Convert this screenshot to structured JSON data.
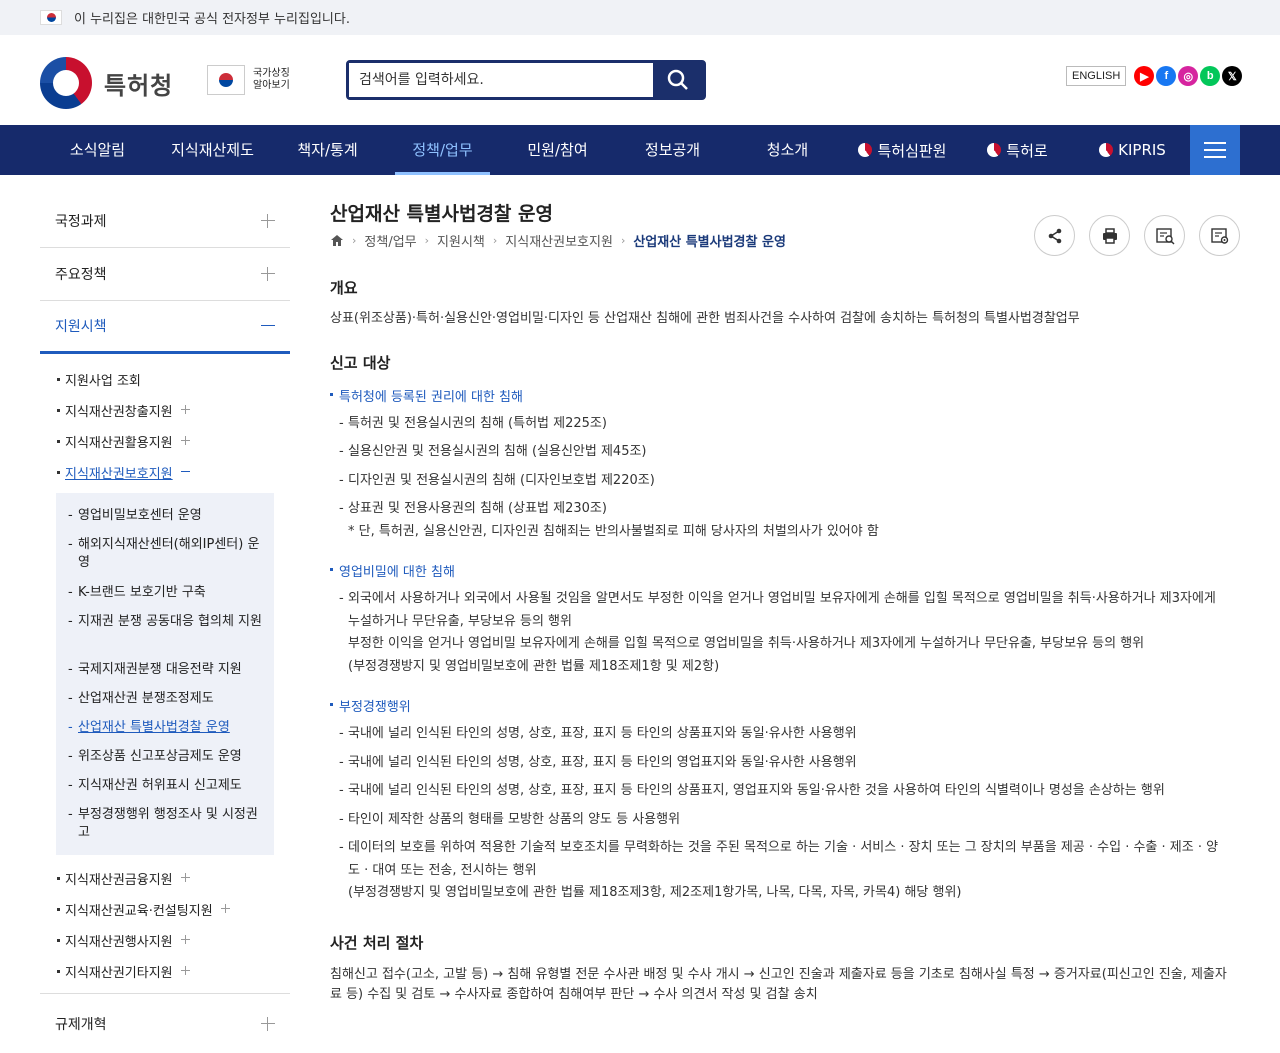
{
  "govbar": {
    "text": "이 누리집은 대한민국 공식 전자정부 누리집입니다."
  },
  "header": {
    "logo_text": "특허청",
    "symbol_text": "국가상징 알아보기",
    "search_placeholder": "검색어를 입력하세요.",
    "english_label": "ENGLISH",
    "sns": [
      {
        "icon": "youtube-icon",
        "glyph": "▶",
        "color": "#ff0000"
      },
      {
        "icon": "facebook-icon",
        "glyph": "f",
        "color": "#1877f2"
      },
      {
        "icon": "instagram-icon",
        "glyph": "◎",
        "color": "#d6249f"
      },
      {
        "icon": "blog-icon",
        "glyph": "b",
        "color": "#03c75a"
      },
      {
        "icon": "x-icon",
        "glyph": "𝕏",
        "color": "#000000"
      }
    ]
  },
  "nav": {
    "items": [
      "소식알림",
      "지식재산제도",
      "책자/통계",
      "정책/업무",
      "민원/참여",
      "정보공개",
      "청소개"
    ],
    "active_index": 3,
    "subsites": [
      "특허심판원",
      "특허로",
      "KIPRIS"
    ],
    "accent": "#162a6b"
  },
  "lnb": {
    "top": [
      "국정과제",
      "주요정책",
      "지원시책"
    ],
    "level2": [
      "지원사업 조회",
      "지식재산권창출지원",
      "지식재산권활용지원",
      "지식재산권보호지원"
    ],
    "level3": [
      "영업비밀보호센터 운영",
      "해외지식재산센터(해외IP센터) 운영",
      "K-브랜드 보호기반 구축",
      "지재권 분쟁 공동대응 협의체 지원",
      "국제지재권분쟁 대응전략 지원",
      "산업재산권 분쟁조정제도",
      "산업재산 특별사법경찰 운영",
      "위조상품 신고포상금제도 운영",
      "지식재산권 허위표시 신고제도",
      "부정경쟁행위 행정조사 및 시정권고"
    ],
    "level2_after": [
      "지식재산권금융지원",
      "지식재산권교육·컨설팅지원",
      "지식재산권행사지원",
      "지식재산권기타지원"
    ],
    "bottom": "규제개혁"
  },
  "content": {
    "title": "산업재산 특별사법경찰 운영",
    "breadcrumb": [
      "정책/업무",
      "지원시책",
      "지식재산권보호지원",
      "산업재산 특별사법경찰 운영"
    ],
    "overview_heading": "개요",
    "overview_text": "상표(위조상품)·특허·실용신안·영업비밀·디자인 등 산업재산 침해에 관한 범죄사건을 수사하여 검찰에 송치하는 특허청의 특별사법경찰업무",
    "report_heading": "신고 대상",
    "sec1_title": "특허청에 등록된 권리에 대한 침해",
    "sec1_items": [
      "특허권 및 전용실시권의 침해 (특허법 제225조)",
      "실용신안권 및 전용실시권의 침해 (실용신안법 제45조)",
      "디자인권 및 전용실시권의 침해 (디자인보호법 제220조)",
      "상표권 및 전용사용권의 침해 (상표법 제230조)"
    ],
    "sec1_note": "* 단, 특허권, 실용신안권, 디자인권 침해죄는 반의사불벌죄로 피해 당사자의 처벌의사가 있어야 함",
    "sec2_title": "영업비밀에 대한 침해",
    "sec2_item_line1": "외국에서 사용하거나 외국에서 사용될 것임을 알면서도 부정한 이익을 얻거나 영업비밀 보유자에게 손해를 입힐 목적으로 영업비밀을 취득·사용하거나 제3자에게",
    "sec2_item_line2": "누설하거나 무단유출, 부당보유 등의 행위",
    "sec2_item_line3": "부정한 이익을 얻거나 영업비밀 보유자에게 손해를 입힐 목적으로 영업비밀을 취득·사용하거나 제3자에게 누설하거나 무단유출, 부당보유 등의 행위",
    "sec2_item_line4": "(부정경쟁방지 및 영업비밀보호에 관한 법률 제18조제1항 및 제2항)",
    "sec3_title": "부정경쟁행위",
    "sec3_items": [
      "국내에 널리 인식된 타인의 성명, 상호, 표장, 표지 등 타인의 상품표지와 동일·유사한 사용행위",
      "국내에 널리 인식된 타인의 성명, 상호, 표장, 표지 등 타인의 영업표지와 동일·유사한 사용행위",
      "국내에 널리 인식된 타인의 성명, 상호, 표장, 표지 등 타인의 상품표지, 영업표지와 동일·유사한 것을 사용하여 타인의 식별력이나 명성을 손상하는 행위",
      "타인이 제작한 상품의 형태를 모방한 상품의 양도 등 사용행위"
    ],
    "sec3_last_line1": "데이터의 보호를 위하여 적용한 기술적 보호조치를 무력화하는 것을 주된 목적으로 하는 기술 · 서비스 · 장치 또는 그 장치의 부품을 제공 · 수입 · 수출 · 제조 · 양",
    "sec3_last_line2": "도 · 대여 또는 전송, 전시하는 행위",
    "sec3_last_line3": "(부정경쟁방지 및 영업비밀보호에 관한 법률 제18조제3항, 제2조제1항가목, 나목, 다목, 자목, 카목4) 해당 행위)",
    "process_heading": "사건 처리 절차",
    "process_line1": "침해신고 접수(고소, 고발 등) → 침해 유형별 전문 수사관 배정 및 수사 개시 → 신고인 진술과 제출자료 등을 기초로 침해사실 특정 → 증거자료(피신고인 진술, 제출자",
    "process_line2": "료 등) 수집 및 검토 → 수사자료 종합하여 침해여부 판단 → 수사 의견서 작성 및 검찰 송치"
  }
}
